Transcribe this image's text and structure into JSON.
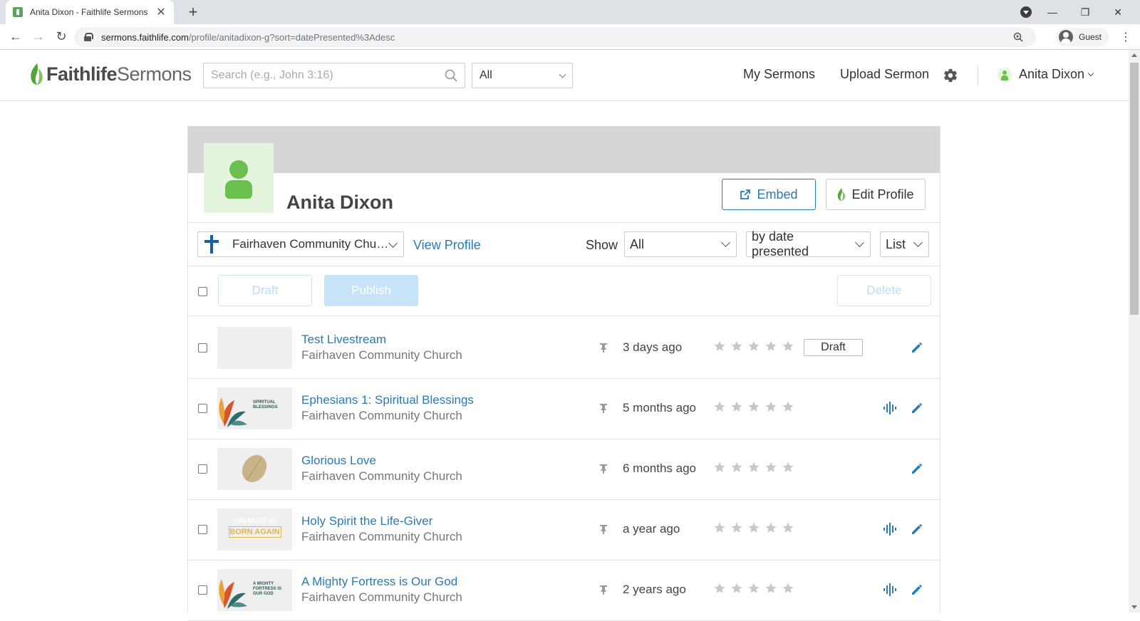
{
  "browser": {
    "tab_title": "Anita Dixon - Faithlife Sermons",
    "url_host": "sermons.faithlife.com",
    "url_path": "/profile/anitadixon-g?sort=datePresented%3Adesc",
    "profile_label": "Guest"
  },
  "header": {
    "logo_part1": "Faithlife",
    "logo_part2": "Sermons",
    "search_placeholder": "Search (e.g., John 3:16)",
    "scope_value": "All",
    "nav_my_sermons": "My Sermons",
    "nav_upload": "Upload Sermon",
    "user_name": "Anita Dixon",
    "brand_color": "#6bbf4e",
    "link_color": "#2a7ab8"
  },
  "profile": {
    "name": "Anita Dixon",
    "embed_label": "Embed",
    "edit_label": "Edit Profile"
  },
  "filters": {
    "church": "Fairhaven Community Church",
    "view_profile": "View Profile",
    "show_label": "Show",
    "show_value": "All",
    "sort_value": "by date presented",
    "view_value": "List"
  },
  "actions": {
    "draft": "Draft",
    "publish": "Publish",
    "delete": "Delete"
  },
  "sermons": [
    {
      "title": "Test Livestream",
      "church": "Fairhaven Community Church",
      "age": "3 days ago",
      "rating": 0,
      "badge": "Draft",
      "has_audio": false,
      "thumb": "blank"
    },
    {
      "title": "Ephesians 1: Spiritual Blessings",
      "church": "Fairhaven Community Church",
      "age": "5 months ago",
      "rating": 0,
      "badge": "",
      "has_audio": true,
      "thumb": "leaf",
      "thumb_text": "SPIRITUAL BLESSINGS"
    },
    {
      "title": "Glorious Love",
      "church": "Fairhaven Community Church",
      "age": "6 months ago",
      "rating": 0,
      "badge": "",
      "has_audio": false,
      "thumb": "light"
    },
    {
      "title": "Holy Spirit the Life-Giver",
      "church": "Fairhaven Community Church",
      "age": "a year ago",
      "rating": 0,
      "badge": "",
      "has_audio": true,
      "thumb": "dark",
      "thumb_text_1": "YOU MUST BE",
      "thumb_text_2": "BORN AGAIN"
    },
    {
      "title": "A Mighty Fortress is Our God",
      "church": "Fairhaven Community Church",
      "age": "2 years ago",
      "rating": 0,
      "badge": "",
      "has_audio": true,
      "thumb": "leaf",
      "thumb_text": "A MIGHTY FORTRESS IS OUR GOD"
    }
  ]
}
